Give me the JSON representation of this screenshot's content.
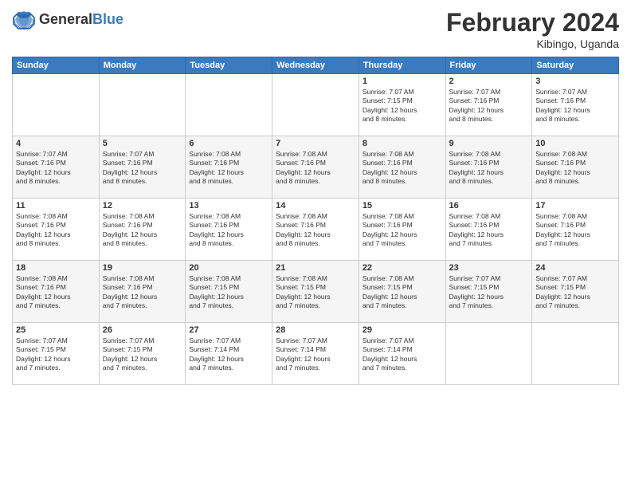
{
  "header": {
    "logo_general": "General",
    "logo_blue": "Blue",
    "month_title": "February 2024",
    "location": "Kibingo, Uganda"
  },
  "days_of_week": [
    "Sunday",
    "Monday",
    "Tuesday",
    "Wednesday",
    "Thursday",
    "Friday",
    "Saturday"
  ],
  "weeks": [
    [
      {
        "day": "",
        "info": ""
      },
      {
        "day": "",
        "info": ""
      },
      {
        "day": "",
        "info": ""
      },
      {
        "day": "",
        "info": ""
      },
      {
        "day": "1",
        "info": "Sunrise: 7:07 AM\nSunset: 7:15 PM\nDaylight: 12 hours\nand 8 minutes."
      },
      {
        "day": "2",
        "info": "Sunrise: 7:07 AM\nSunset: 7:16 PM\nDaylight: 12 hours\nand 8 minutes."
      },
      {
        "day": "3",
        "info": "Sunrise: 7:07 AM\nSunset: 7:16 PM\nDaylight: 12 hours\nand 8 minutes."
      }
    ],
    [
      {
        "day": "4",
        "info": "Sunrise: 7:07 AM\nSunset: 7:16 PM\nDaylight: 12 hours\nand 8 minutes."
      },
      {
        "day": "5",
        "info": "Sunrise: 7:07 AM\nSunset: 7:16 PM\nDaylight: 12 hours\nand 8 minutes."
      },
      {
        "day": "6",
        "info": "Sunrise: 7:08 AM\nSunset: 7:16 PM\nDaylight: 12 hours\nand 8 minutes."
      },
      {
        "day": "7",
        "info": "Sunrise: 7:08 AM\nSunset: 7:16 PM\nDaylight: 12 hours\nand 8 minutes."
      },
      {
        "day": "8",
        "info": "Sunrise: 7:08 AM\nSunset: 7:16 PM\nDaylight: 12 hours\nand 8 minutes."
      },
      {
        "day": "9",
        "info": "Sunrise: 7:08 AM\nSunset: 7:16 PM\nDaylight: 12 hours\nand 8 minutes."
      },
      {
        "day": "10",
        "info": "Sunrise: 7:08 AM\nSunset: 7:16 PM\nDaylight: 12 hours\nand 8 minutes."
      }
    ],
    [
      {
        "day": "11",
        "info": "Sunrise: 7:08 AM\nSunset: 7:16 PM\nDaylight: 12 hours\nand 8 minutes."
      },
      {
        "day": "12",
        "info": "Sunrise: 7:08 AM\nSunset: 7:16 PM\nDaylight: 12 hours\nand 8 minutes."
      },
      {
        "day": "13",
        "info": "Sunrise: 7:08 AM\nSunset: 7:16 PM\nDaylight: 12 hours\nand 8 minutes."
      },
      {
        "day": "14",
        "info": "Sunrise: 7:08 AM\nSunset: 7:16 PM\nDaylight: 12 hours\nand 8 minutes."
      },
      {
        "day": "15",
        "info": "Sunrise: 7:08 AM\nSunset: 7:16 PM\nDaylight: 12 hours\nand 7 minutes."
      },
      {
        "day": "16",
        "info": "Sunrise: 7:08 AM\nSunset: 7:16 PM\nDaylight: 12 hours\nand 7 minutes."
      },
      {
        "day": "17",
        "info": "Sunrise: 7:08 AM\nSunset: 7:16 PM\nDaylight: 12 hours\nand 7 minutes."
      }
    ],
    [
      {
        "day": "18",
        "info": "Sunrise: 7:08 AM\nSunset: 7:16 PM\nDaylight: 12 hours\nand 7 minutes."
      },
      {
        "day": "19",
        "info": "Sunrise: 7:08 AM\nSunset: 7:16 PM\nDaylight: 12 hours\nand 7 minutes."
      },
      {
        "day": "20",
        "info": "Sunrise: 7:08 AM\nSunset: 7:15 PM\nDaylight: 12 hours\nand 7 minutes."
      },
      {
        "day": "21",
        "info": "Sunrise: 7:08 AM\nSunset: 7:15 PM\nDaylight: 12 hours\nand 7 minutes."
      },
      {
        "day": "22",
        "info": "Sunrise: 7:08 AM\nSunset: 7:15 PM\nDaylight: 12 hours\nand 7 minutes."
      },
      {
        "day": "23",
        "info": "Sunrise: 7:07 AM\nSunset: 7:15 PM\nDaylight: 12 hours\nand 7 minutes."
      },
      {
        "day": "24",
        "info": "Sunrise: 7:07 AM\nSunset: 7:15 PM\nDaylight: 12 hours\nand 7 minutes."
      }
    ],
    [
      {
        "day": "25",
        "info": "Sunrise: 7:07 AM\nSunset: 7:15 PM\nDaylight: 12 hours\nand 7 minutes."
      },
      {
        "day": "26",
        "info": "Sunrise: 7:07 AM\nSunset: 7:15 PM\nDaylight: 12 hours\nand 7 minutes."
      },
      {
        "day": "27",
        "info": "Sunrise: 7:07 AM\nSunset: 7:14 PM\nDaylight: 12 hours\nand 7 minutes."
      },
      {
        "day": "28",
        "info": "Sunrise: 7:07 AM\nSunset: 7:14 PM\nDaylight: 12 hours\nand 7 minutes."
      },
      {
        "day": "29",
        "info": "Sunrise: 7:07 AM\nSunset: 7:14 PM\nDaylight: 12 hours\nand 7 minutes."
      },
      {
        "day": "",
        "info": ""
      },
      {
        "day": "",
        "info": ""
      }
    ]
  ]
}
